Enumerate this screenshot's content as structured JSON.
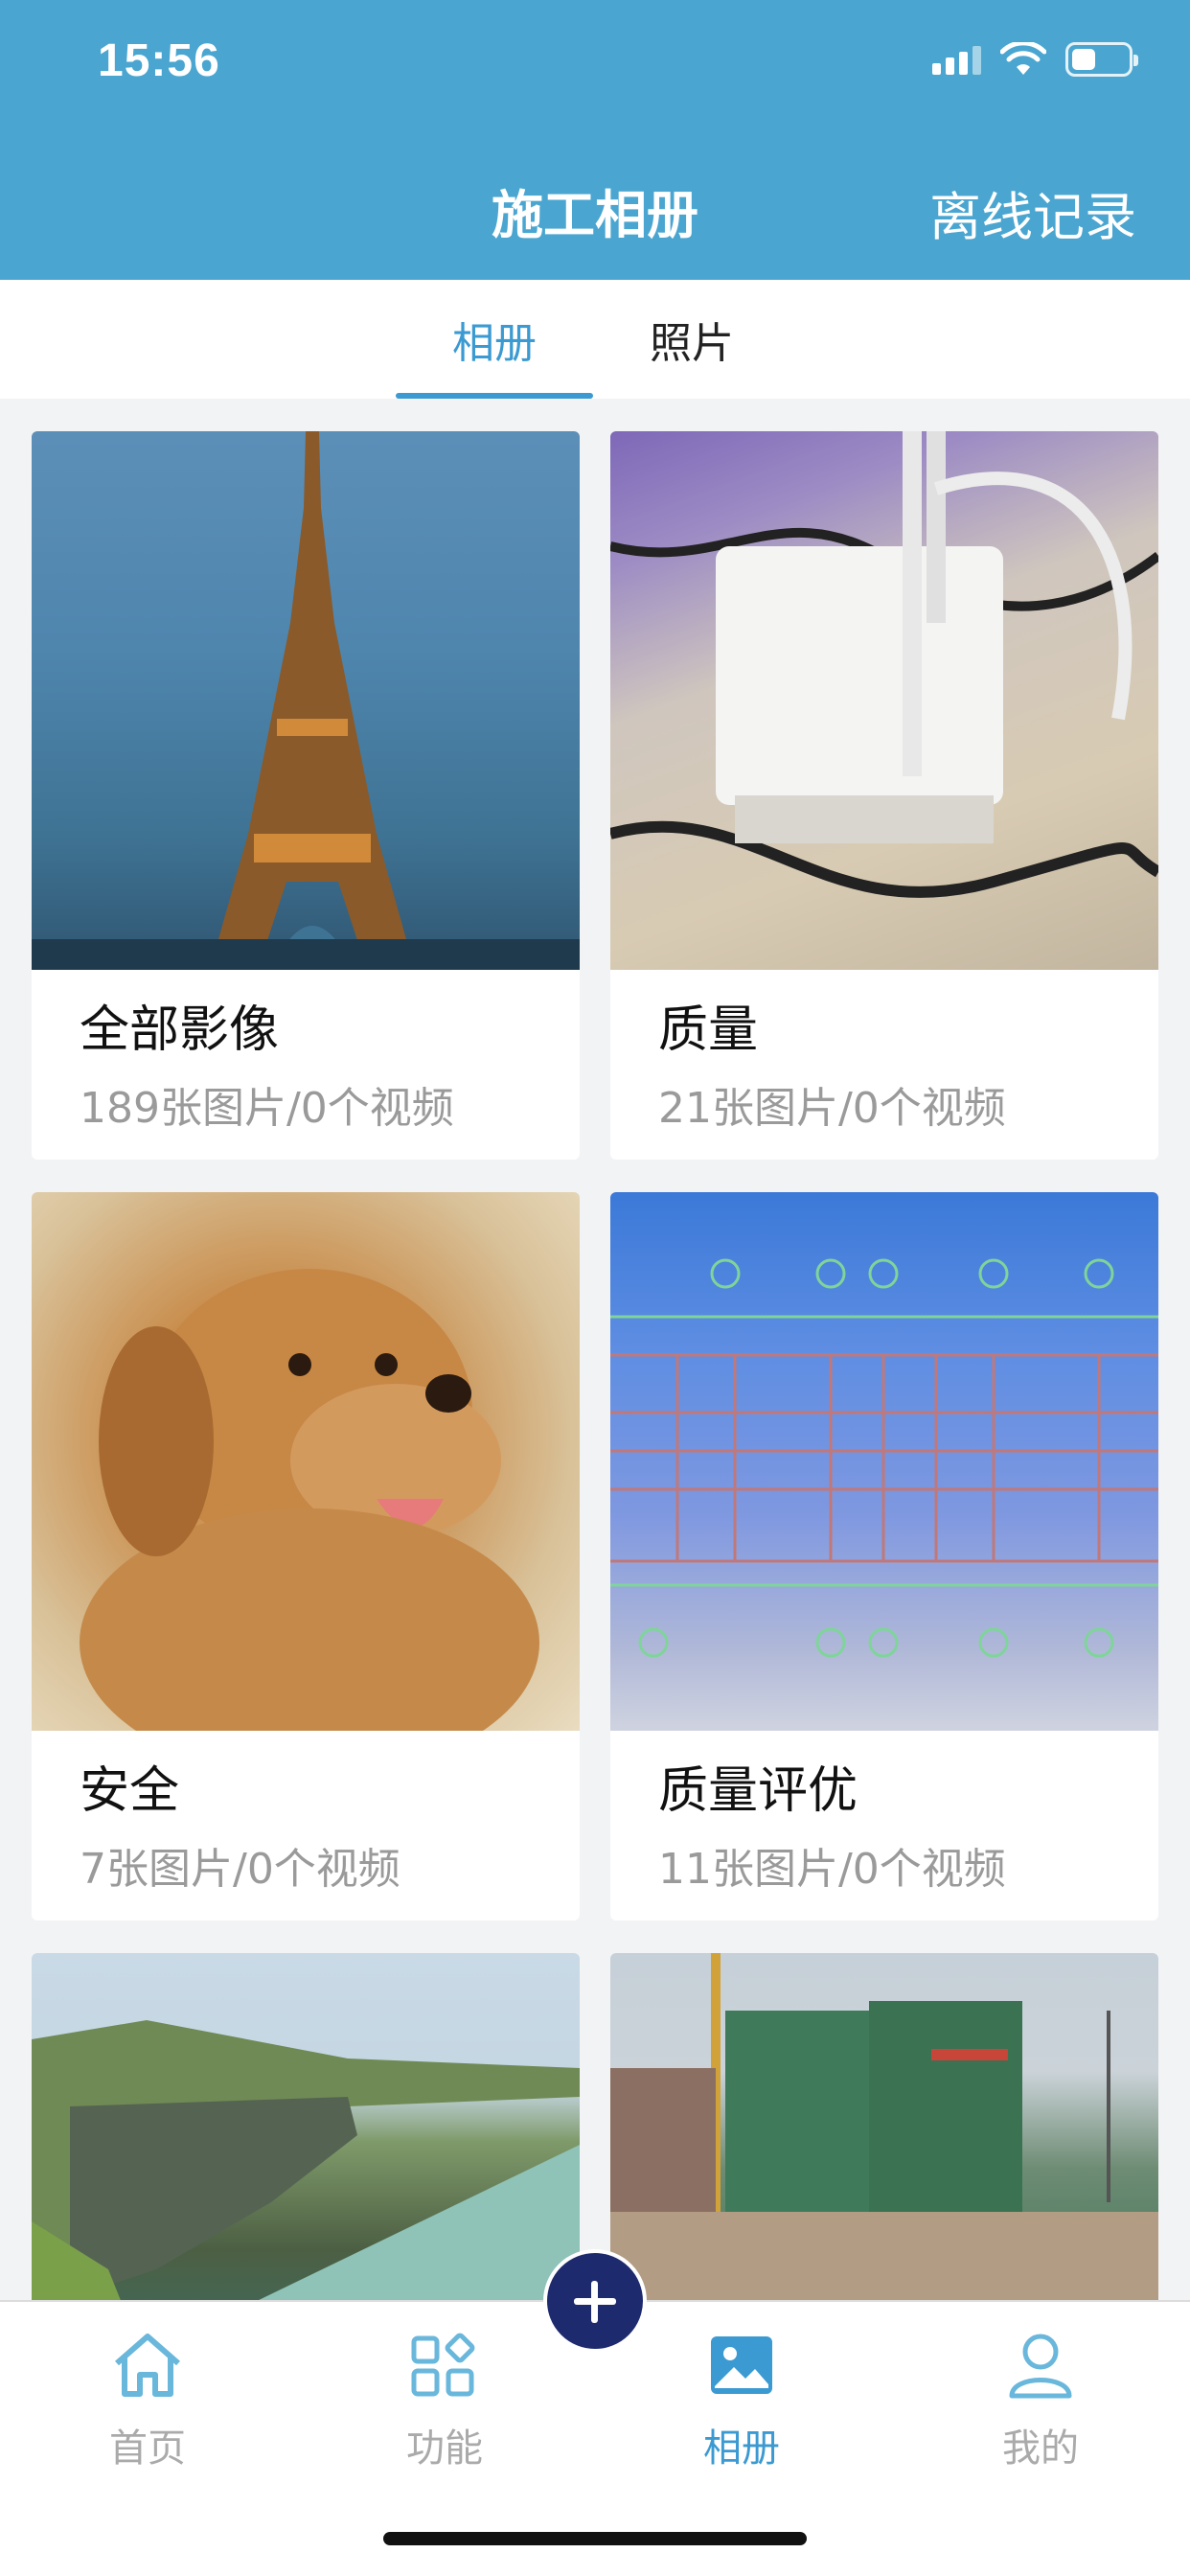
{
  "status_bar": {
    "time": "15:56"
  },
  "header": {
    "title": "施工相册",
    "action_label": "离线记录"
  },
  "tabs": [
    {
      "label": "相册",
      "active": true
    },
    {
      "label": "照片",
      "active": false
    }
  ],
  "albums": [
    {
      "name": "全部影像",
      "count": "189张图片/0个视频",
      "cover": "eiffel-tower-photo"
    },
    {
      "name": "质量",
      "count": "21张图片/0个视频",
      "cover": "power-adapter-photo"
    },
    {
      "name": "安全",
      "count": "7张图片/0个视频",
      "cover": "golden-retriever-photo"
    },
    {
      "name": "质量评优",
      "count": "11张图片/0个视频",
      "cover": "floor-plan-drawing"
    },
    {
      "name": "",
      "count": "",
      "cover": "coastal-cliff-photo"
    },
    {
      "name": "",
      "count": "",
      "cover": "construction-site-photo"
    }
  ],
  "bottom_nav": {
    "items": [
      {
        "label": "首页",
        "icon": "home-icon",
        "active": false
      },
      {
        "label": "功能",
        "icon": "apps-grid-icon",
        "active": false
      },
      {
        "label": "相册",
        "icon": "image-album-icon",
        "active": true
      },
      {
        "label": "我的",
        "icon": "user-profile-icon",
        "active": false
      }
    ]
  },
  "colors": {
    "header_bg": "#4aa6d0",
    "accent": "#3b9ad1",
    "fab_bg": "#1e2a6e"
  }
}
